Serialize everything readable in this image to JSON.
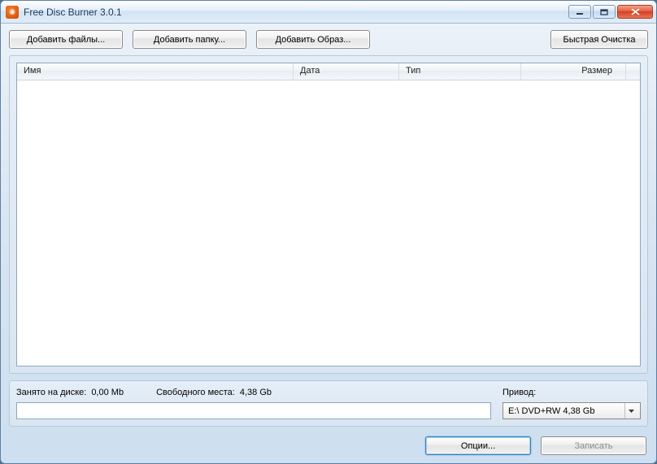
{
  "window": {
    "title": "Free Disc Burner  3.0.1"
  },
  "toolbar": {
    "add_files": "Добавить файлы...",
    "add_folder": "Добавить папку...",
    "add_image": "Добавить Образ...",
    "quick_erase": "Быстрая Очистка"
  },
  "columns": {
    "name": "Имя",
    "date": "Дата",
    "type": "Тип",
    "size": "Размер"
  },
  "status": {
    "used_label": "Занято на диске:",
    "used_value": "0,00 Mb",
    "free_label": "Свободного места:",
    "free_value": "4,38 Gb",
    "drive_label": "Привод:",
    "drive_selected": "E:\\ DVD+RW 4,38 Gb"
  },
  "footer": {
    "options": "Опции...",
    "burn": "Записать"
  }
}
